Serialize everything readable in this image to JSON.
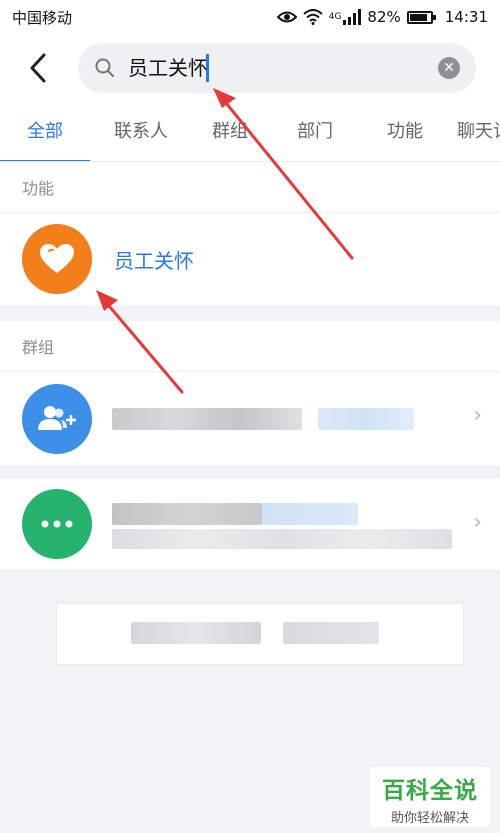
{
  "status_bar": {
    "carrier": "中国移动",
    "network": "4G",
    "battery": "82%",
    "time": "14:31"
  },
  "search": {
    "query": "员工关怀",
    "placeholder": ""
  },
  "tabs": [
    {
      "label": "全部",
      "active": true
    },
    {
      "label": "联系人",
      "active": false
    },
    {
      "label": "群组",
      "active": false
    },
    {
      "label": "部门",
      "active": false
    },
    {
      "label": "功能",
      "active": false
    },
    {
      "label": "聊天记录",
      "active": false
    }
  ],
  "sections": {
    "function": {
      "label": "功能",
      "item": {
        "title": "员工关怀",
        "icon": "heart-icon",
        "color": "#f37f1b"
      }
    },
    "group": {
      "label": "群组",
      "items": [
        {
          "icon": "add-group-icon",
          "color": "#3d8fe8"
        },
        {
          "icon": "more-icon",
          "color": "#25b36e"
        }
      ]
    }
  },
  "watermark": {
    "main": "百科全说",
    "sub": "助你轻松解决"
  },
  "colors": {
    "accent": "#2a7ae2",
    "arrow": "#e43a3a"
  }
}
